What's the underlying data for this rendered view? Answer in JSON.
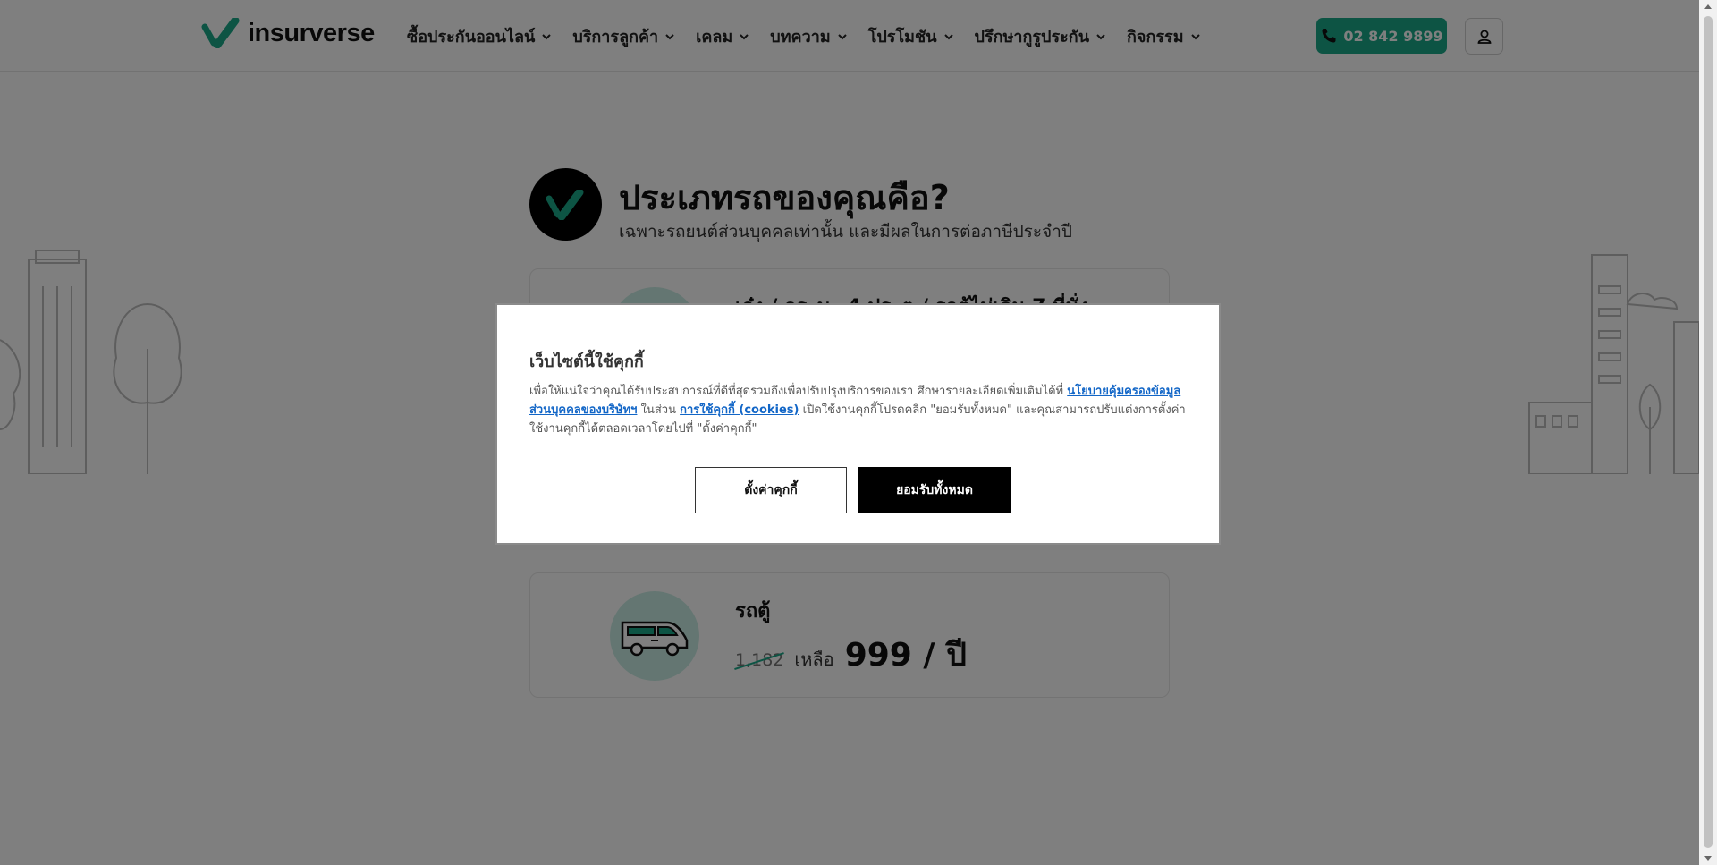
{
  "brand": {
    "name": "insurverse",
    "accent": "#1aa889"
  },
  "nav": {
    "items": [
      {
        "label": "ซื้อประกันออนไลน์"
      },
      {
        "label": "บริการลูกค้า"
      },
      {
        "label": "เคลม"
      },
      {
        "label": "บทความ"
      },
      {
        "label": "โปรโมชัน"
      },
      {
        "label": "ปรึกษากูรูประกัน"
      },
      {
        "label": "กิจกรรม"
      }
    ],
    "phone": "02 842 9899",
    "user_icon": "user-icon"
  },
  "hero": {
    "title": "ประเภทรถของคุณคือ?",
    "subtitle": "เฉพาะรถยนต์ส่วนบุคคลเท่านั้น และมีผลในการต่อภาษีประจำปี"
  },
  "cards": [
    {
      "title": "เก๋ง / กระบะ 4 ประตู / รถตู้ไม่เกิน 7 ที่นั่ง",
      "icon": "car-icon"
    },
    {
      "title": "รถตู้",
      "old_price": "1,182",
      "price_word": "เหลือ",
      "price": "999 / ปี",
      "icon": "van-icon"
    }
  ],
  "cookie_modal": {
    "title": "เว็บไซต์นี้ใช้คุกกี้",
    "text_1": "เพื่อให้แน่ใจว่าคุณได้รับประสบการณ์ที่ดีที่สุดรวมถึงเพื่อปรับปรุงบริการของเรา ศึกษารายละเอียดเพิ่มเติมได้ที่",
    "link_privacy": "นโยบายคุ้มครองข้อมูลส่วนบุคคลของบริษัทฯ",
    "text_2": "ในส่วน",
    "link_cookies": "การใช้คุกกี้ (cookies)",
    "text_3": "เปิดใช้งานคุกกี้โปรดคลิก \"ยอมรับทั้งหมด\" และคุณสามารถปรับแต่งการตั้งค่าใช้งานคุกกี้ได้ตลอดเวลาโดยไปที่ \"ตั้งค่าคุกกี้\"",
    "settings_label": "ตั้งค่าคุกกี้",
    "accept_label": "ยอมรับทั้งหมด"
  }
}
